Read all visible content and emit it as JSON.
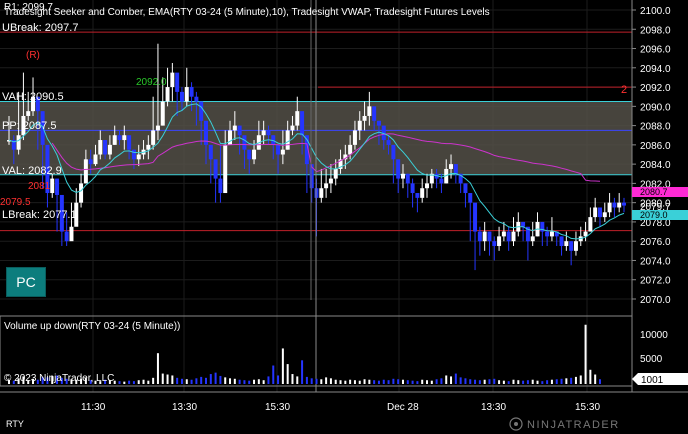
{
  "header": {
    "indicators": "Tradesight Seeker and Comber, EMA(RTY 03-24 (5 Minute),10), Tradesight VWAP, Tradesight Futures Levels",
    "r1_label": "R1: 2099.7"
  },
  "levels": [
    {
      "label": "UBreak: 2097.7",
      "price": 2097.7,
      "color": "#c0202a"
    },
    {
      "label": "VAH: 2090.5",
      "price": 2090.5,
      "color": "#3ad0d8"
    },
    {
      "label": "PP: 2087.5",
      "price": 2087.5,
      "color": "#3a45ff"
    },
    {
      "label": "VAL: 2082.9",
      "price": 2082.9,
      "color": "#3ad0d8"
    },
    {
      "label": "LBreak: 2077.1",
      "price": 2077.1,
      "color": "#c0202a"
    }
  ],
  "annotations": {
    "r_marker": "(R)",
    "level_2092": "2092.0",
    "level_2081": "2081",
    "level_2079": "2079.5",
    "right_edge_mark": "2"
  },
  "price_axis": {
    "ticks": [
      "2100.0",
      "2098.0",
      "2096.0",
      "2094.0",
      "2092.0",
      "2090.0",
      "2088.0",
      "2086.0",
      "2084.0",
      "2082.0",
      "2080.0",
      "2078.0",
      "2076.0",
      "2074.0",
      "2072.0",
      "2070.0"
    ],
    "tag_vwap": {
      "text": "2080.7",
      "color": "#ff2ad4"
    },
    "tag_last": {
      "text": "2079.7",
      "color": "#ffffff"
    },
    "tag_ema": {
      "text": "2079.0",
      "color": "#3ad0d8"
    }
  },
  "volume_panel": {
    "title": "Volume up down(RTY 03-24 (5 Minute))",
    "ticks": [
      "10000",
      "5000"
    ],
    "last_value": "1001",
    "copyright": "© 2023 NinjaTrader, LLC"
  },
  "time_axis": {
    "labels": [
      "11:30",
      "13:30",
      "15:30",
      "Dec 28",
      "13:30",
      "15:30"
    ]
  },
  "pc_button": "PC",
  "footer": {
    "instrument": "RTY",
    "brand": "NINJATRADER"
  },
  "colors": {
    "up_bar": "#ffffff",
    "down_bar": "#2535ff",
    "ema": "#3ad0d8",
    "vwap": "#cc33cc",
    "value_area": "#545048"
  },
  "price_series": [
    [
      2086.5,
      2086.0,
      2089.0
    ],
    [
      2085.5,
      2084.0,
      2087.0
    ],
    [
      2087.0,
      2085.0,
      2091.5
    ],
    [
      2089.0,
      2086.5,
      2093.5
    ],
    [
      2089.5,
      2088.5,
      2091.5
    ],
    [
      2091.0,
      2089.0,
      2093.0
    ],
    [
      2089.5,
      2085.5,
      2091.0
    ],
    [
      2086.0,
      2081.5,
      2087.0
    ],
    [
      2081.0,
      2079.5,
      2082.5
    ],
    [
      2082.5,
      2080.5,
      2083.0
    ],
    [
      2080.8,
      2077.0,
      2082.5
    ],
    [
      2077.0,
      2075.5,
      2078.0
    ],
    [
      2076.0,
      2075.5,
      2079.0
    ],
    [
      2077.5,
      2076.5,
      2080.0
    ],
    [
      2080.0,
      2077.8,
      2081.5
    ],
    [
      2082.0,
      2079.5,
      2083.0
    ],
    [
      2084.5,
      2082.0,
      2085.5
    ],
    [
      2084.0,
      2083.0,
      2085.5
    ],
    [
      2085.0,
      2083.8,
      2086.0
    ],
    [
      2086.5,
      2084.5,
      2087.5
    ],
    [
      2085.0,
      2084.5,
      2086.5
    ],
    [
      2086.0,
      2084.5,
      2087.0
    ],
    [
      2087.0,
      2086.0,
      2088.0
    ],
    [
      2086.5,
      2086.0,
      2087.5
    ],
    [
      2087.0,
      2085.5,
      2088.0
    ],
    [
      2085.5,
      2084.5,
      2086.5
    ],
    [
      2084.5,
      2083.5,
      2085.5
    ],
    [
      2085.0,
      2083.8,
      2086.0
    ],
    [
      2085.5,
      2084.5,
      2086.5
    ],
    [
      2086.0,
      2084.5,
      2087.0
    ],
    [
      2087.5,
      2085.5,
      2091.0
    ],
    [
      2088.0,
      2086.5,
      2096.5
    ],
    [
      2090.5,
      2088.0,
      2093.0
    ],
    [
      2092.0,
      2090.0,
      2094.0
    ],
    [
      2093.5,
      2090.5,
      2094.5
    ],
    [
      2091.5,
      2089.0,
      2093.0
    ],
    [
      2090.5,
      2089.5,
      2092.0
    ],
    [
      2092.0,
      2090.0,
      2094.0
    ],
    [
      2091.0,
      2089.5,
      2092.5
    ],
    [
      2090.5,
      2088.0,
      2091.5
    ],
    [
      2088.5,
      2086.0,
      2089.5
    ],
    [
      2086.0,
      2084.0,
      2087.5
    ],
    [
      2084.5,
      2082.0,
      2085.5
    ],
    [
      2082.5,
      2080.0,
      2083.0
    ],
    [
      2081.0,
      2080.0,
      2086.0
    ],
    [
      2086.0,
      2084.5,
      2087.5
    ],
    [
      2087.5,
      2086.0,
      2088.5
    ],
    [
      2088.0,
      2086.5,
      2089.5
    ],
    [
      2087.0,
      2085.0,
      2088.0
    ],
    [
      2085.5,
      2083.5,
      2086.5
    ],
    [
      2084.5,
      2083.0,
      2085.5
    ],
    [
      2085.5,
      2084.0,
      2086.5
    ],
    [
      2087.0,
      2085.5,
      2088.5
    ],
    [
      2087.5,
      2086.0,
      2088.5
    ],
    [
      2087.0,
      2086.0,
      2088.0
    ],
    [
      2086.0,
      2084.5,
      2087.0
    ],
    [
      2085.0,
      2083.0,
      2086.0
    ],
    [
      2085.5,
      2084.0,
      2087.5
    ],
    [
      2087.5,
      2085.5,
      2088.5
    ],
    [
      2088.0,
      2087.0,
      2089.0
    ],
    [
      2089.5,
      2087.5,
      2091.0
    ],
    [
      2087.0,
      2085.0,
      2088.5
    ],
    [
      2084.0,
      2081.0,
      2085.5
    ],
    [
      2081.5,
      2080.0,
      2083.0
    ],
    [
      2080.5,
      2076.5,
      2082.5
    ],
    [
      2081.5,
      2080.0,
      2083.5
    ],
    [
      2082.0,
      2080.5,
      2083.5
    ],
    [
      2082.5,
      2081.0,
      2084.0
    ],
    [
      2083.5,
      2081.8,
      2084.5
    ],
    [
      2084.5,
      2083.0,
      2085.5
    ],
    [
      2085.0,
      2083.5,
      2086.0
    ],
    [
      2086.0,
      2084.5,
      2087.0
    ],
    [
      2087.5,
      2085.5,
      2088.5
    ],
    [
      2088.5,
      2086.5,
      2089.5
    ],
    [
      2089.0,
      2087.5,
      2090.5
    ],
    [
      2090.0,
      2088.0,
      2091.5
    ],
    [
      2088.5,
      2087.5,
      2089.5
    ],
    [
      2088.0,
      2086.0,
      2088.5
    ],
    [
      2086.5,
      2085.5,
      2087.5
    ],
    [
      2086.0,
      2085.0,
      2087.0
    ],
    [
      2084.5,
      2082.0,
      2085.5
    ],
    [
      2082.5,
      2081.0,
      2084.0
    ],
    [
      2083.0,
      2081.5,
      2084.0
    ],
    [
      2082.0,
      2080.5,
      2083.0
    ],
    [
      2081.0,
      2079.5,
      2082.5
    ],
    [
      2080.5,
      2079.0,
      2081.0
    ],
    [
      2081.5,
      2080.0,
      2082.5
    ],
    [
      2082.0,
      2080.5,
      2083.0
    ],
    [
      2083.0,
      2081.5,
      2083.5
    ],
    [
      2082.5,
      2081.5,
      2083.5
    ],
    [
      2082.0,
      2081.0,
      2083.0
    ],
    [
      2083.5,
      2082.0,
      2084.5
    ],
    [
      2084.0,
      2082.5,
      2085.0
    ],
    [
      2083.0,
      2082.0,
      2084.0
    ],
    [
      2082.0,
      2081.0,
      2083.0
    ],
    [
      2081.0,
      2079.5,
      2082.0
    ],
    [
      2080.0,
      2076.0,
      2081.0
    ],
    [
      2077.0,
      2073.0,
      2078.0
    ],
    [
      2076.0,
      2074.5,
      2077.5
    ],
    [
      2077.0,
      2075.0,
      2078.0
    ],
    [
      2076.0,
      2074.5,
      2077.0
    ],
    [
      2075.5,
      2074.0,
      2076.5
    ],
    [
      2076.5,
      2075.0,
      2077.5
    ],
    [
      2077.0,
      2076.0,
      2078.0
    ],
    [
      2076.0,
      2075.0,
      2077.5
    ],
    [
      2077.0,
      2075.5,
      2078.5
    ],
    [
      2078.0,
      2076.5,
      2079.0
    ],
    [
      2077.5,
      2076.0,
      2078.0
    ],
    [
      2076.0,
      2074.0,
      2077.0
    ],
    [
      2076.5,
      2075.5,
      2078.0
    ],
    [
      2078.0,
      2076.5,
      2079.0
    ],
    [
      2077.0,
      2075.5,
      2078.0
    ],
    [
      2076.5,
      2075.5,
      2077.5
    ],
    [
      2077.0,
      2076.0,
      2078.5
    ],
    [
      2076.5,
      2075.5,
      2077.0
    ],
    [
      2075.5,
      2074.5,
      2076.5
    ],
    [
      2076.0,
      2075.0,
      2077.0
    ],
    [
      2075.0,
      2073.5,
      2076.0
    ],
    [
      2076.0,
      2074.5,
      2077.0
    ],
    [
      2076.5,
      2075.5,
      2077.5
    ],
    [
      2077.0,
      2076.0,
      2078.0
    ],
    [
      2078.5,
      2077.0,
      2079.5
    ],
    [
      2079.5,
      2078.0,
      2080.5
    ],
    [
      2078.5,
      2077.5,
      2079.5
    ],
    [
      2079.0,
      2078.0,
      2080.0
    ],
    [
      2080.0,
      2078.5,
      2081.0
    ],
    [
      2079.5,
      2078.5,
      2080.5
    ],
    [
      2080.0,
      2079.0,
      2081.0
    ],
    [
      2079.7,
      2079.0,
      2080.5
    ]
  ],
  "volume_series": [
    900,
    700,
    1200,
    1600,
    800,
    1100,
    900,
    1500,
    1400,
    1700,
    1800,
    1300,
    1100,
    1000,
    900,
    1100,
    1300,
    800,
    700,
    600,
    900,
    800,
    700,
    600,
    500,
    700,
    600,
    800,
    900,
    700,
    1300,
    6500,
    2200,
    2000,
    1800,
    1300,
    1100,
    1000,
    900,
    1200,
    1500,
    1300,
    2100,
    2400,
    1700,
    1400,
    1200,
    1100,
    900,
    800,
    700,
    900,
    1000,
    800,
    1600,
    3900,
    1800,
    7500,
    4200,
    2100,
    1600,
    5000,
    1500,
    1200,
    1100,
    1000,
    1400,
    1200,
    900,
    800,
    700,
    900,
    800,
    700,
    1000,
    900,
    800,
    700,
    900,
    800,
    1100,
    1000,
    900,
    800,
    700,
    600,
    900,
    800,
    700,
    1000,
    1200,
    1800,
    1600,
    2200,
    1400,
    1200,
    1000,
    900,
    800,
    900,
    1000,
    1100,
    800,
    700,
    600,
    900,
    800,
    700,
    800,
    900,
    700,
    600,
    800,
    900,
    1000,
    1100,
    1200,
    1300,
    1500,
    1800,
    12500,
    3000,
    2000,
    1001
  ]
}
